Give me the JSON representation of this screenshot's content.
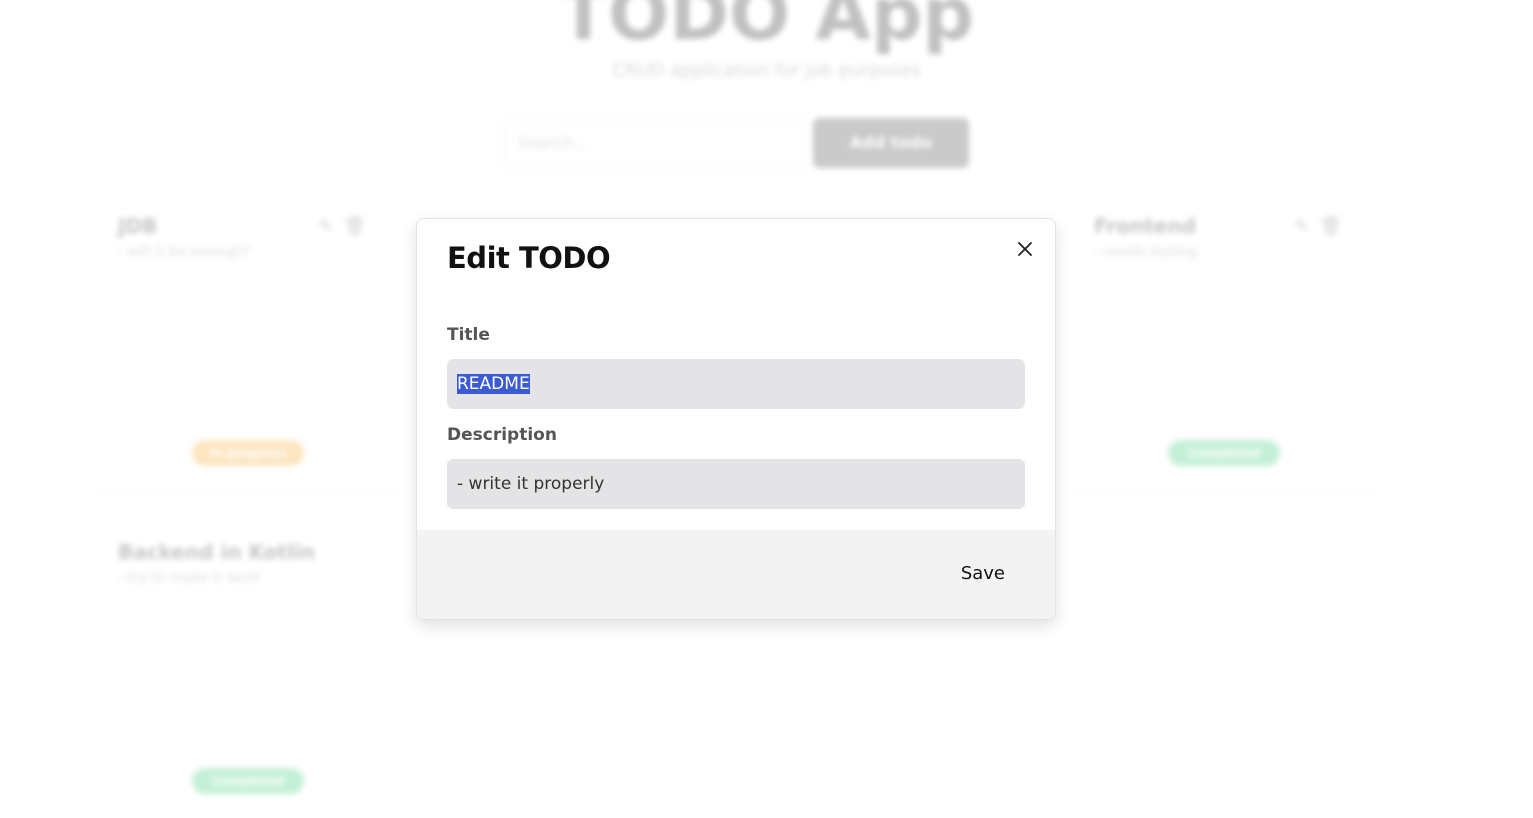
{
  "background": {
    "app_title": "TODO App",
    "app_subtitle": "CRUD application for job purposes",
    "search_placeholder": "Search...",
    "add_button_label": "Add todo",
    "cards": [
      {
        "title": "JDB",
        "description": "- will it be enough?",
        "badge": "In progress",
        "badge_color": "#f5a623"
      },
      {
        "title": "Frontend",
        "description": "- needs styling",
        "badge": "Completed",
        "badge_color": "#2ecc71"
      },
      {
        "title": "Backend in Kotlin",
        "description": "- try to make it work",
        "badge": "Completed",
        "badge_color": "#2ecc71"
      }
    ]
  },
  "modal": {
    "title": "Edit TODO",
    "title_field_label": "Title",
    "title_value": "README",
    "description_field_label": "Description",
    "description_value": "- write it properly",
    "save_label": "Save"
  },
  "colors": {
    "selection": "#3a5bd1",
    "input_bg": "#e4e4e7",
    "footer_bg": "#f3f3f3"
  }
}
